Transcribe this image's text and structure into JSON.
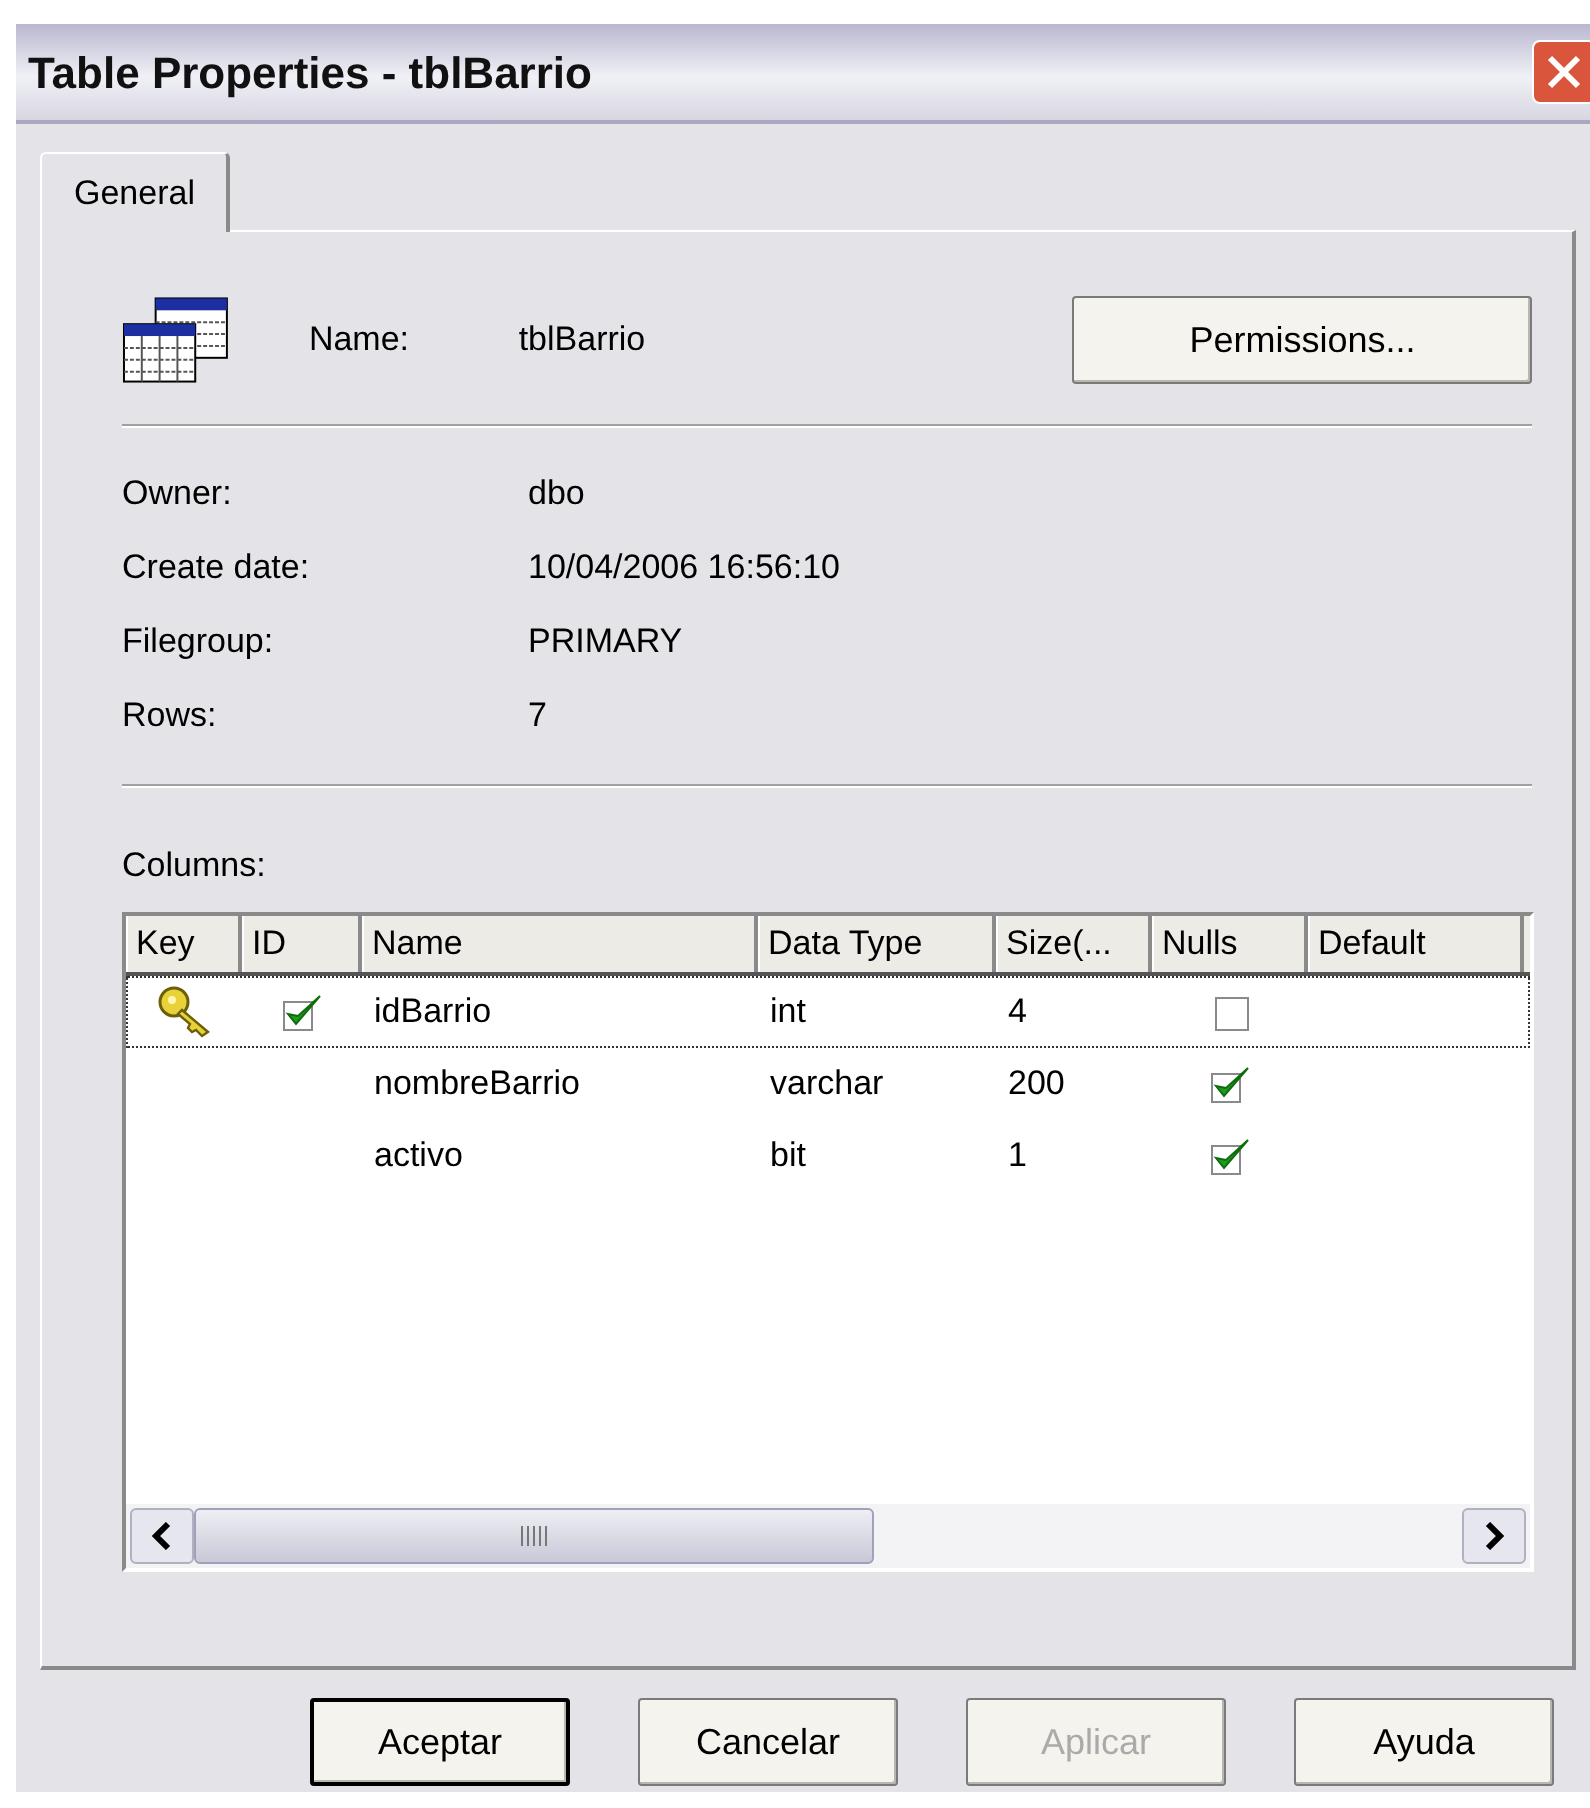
{
  "window": {
    "title": "Table Properties - tblBarrio"
  },
  "tabs": [
    {
      "label": "General",
      "selected": true
    }
  ],
  "name_row": {
    "label": "Name:",
    "value": "tblBarrio",
    "button": "Permissions..."
  },
  "properties": [
    {
      "label": "Owner:",
      "value": "dbo"
    },
    {
      "label": "Create date:",
      "value": "10/04/2006 16:56:10"
    },
    {
      "label": "Filegroup:",
      "value": "PRIMARY"
    },
    {
      "label": "Rows:",
      "value": "7"
    }
  ],
  "columns_label": "Columns:",
  "table": {
    "columns": [
      "Key",
      "ID",
      "Name",
      "Data Type",
      "Size(...",
      "Nulls",
      "Default"
    ],
    "rows": [
      {
        "key": true,
        "identity": true,
        "name": "idBarrio",
        "data_type": "int",
        "size": "4",
        "nulls": false,
        "selected": true
      },
      {
        "key": false,
        "identity": false,
        "name": "nombreBarrio",
        "data_type": "varchar",
        "size": "200",
        "nulls": true,
        "selected": false
      },
      {
        "key": false,
        "identity": false,
        "name": "activo",
        "data_type": "bit",
        "size": "1",
        "nulls": true,
        "selected": false
      }
    ]
  },
  "buttons": [
    {
      "label": "Aceptar",
      "default": true,
      "disabled": false
    },
    {
      "label": "Cancelar",
      "default": false,
      "disabled": false
    },
    {
      "label": "Aplicar",
      "default": false,
      "disabled": true
    },
    {
      "label": "Ayuda",
      "default": false,
      "disabled": false
    }
  ]
}
